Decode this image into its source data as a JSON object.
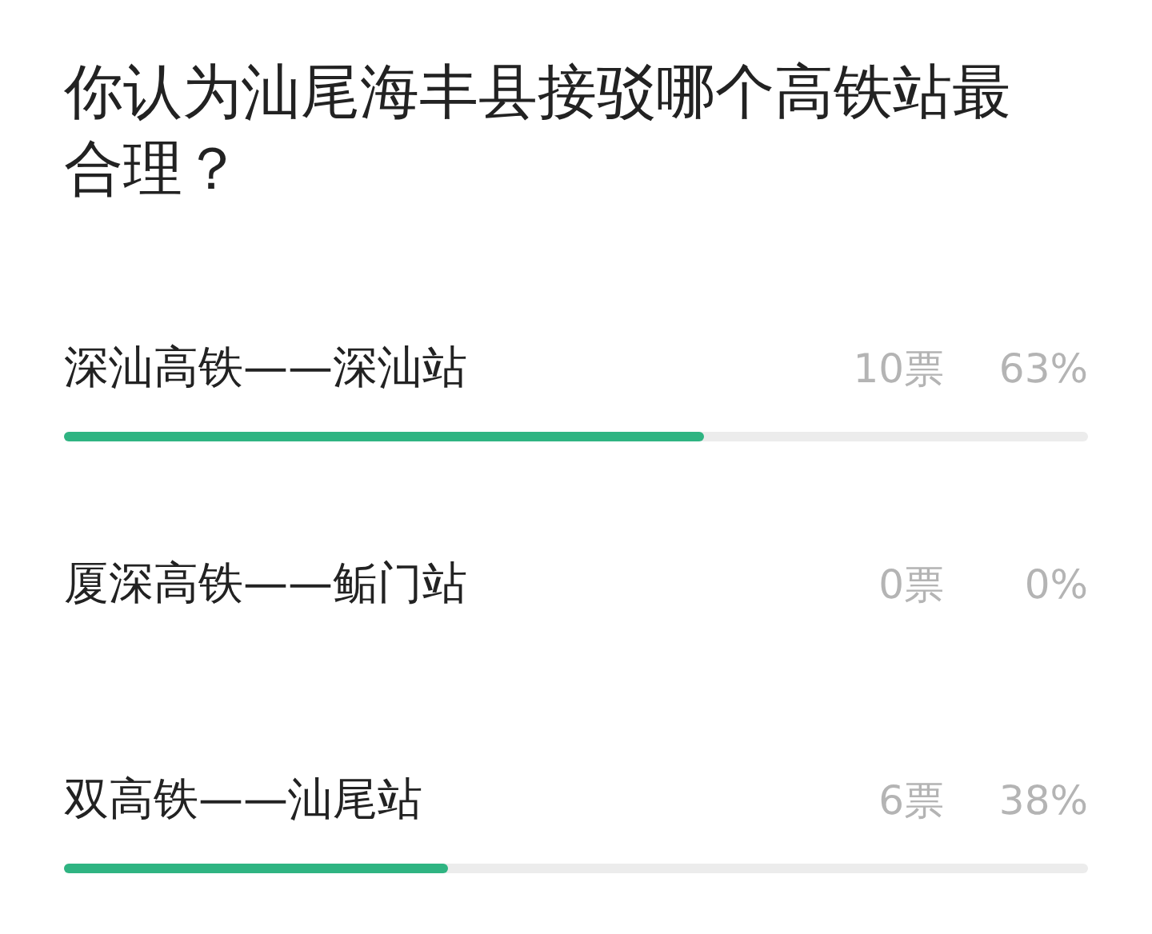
{
  "question": "你认为汕尾海丰县接驳哪个高铁站最合理？",
  "options": [
    {
      "label": "深汕高铁——深汕站",
      "votes": "10票",
      "percent": "63%",
      "level": 0.625
    },
    {
      "label": "厦深高铁——鲘门站",
      "votes": "0票",
      "percent": "0%"
    },
    {
      "label": "双高铁——汕尾站",
      "votes": "6票",
      "percent": "38%",
      "level": 0.375
    }
  ]
}
